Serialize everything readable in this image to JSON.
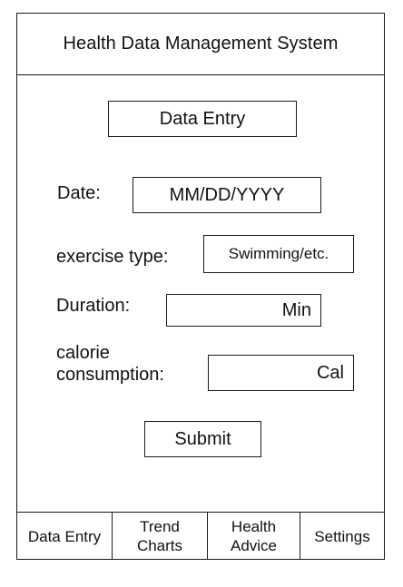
{
  "header": {
    "title": "Health Data Management System"
  },
  "form": {
    "section_button": "Data Entry",
    "date_label": "Date:",
    "date_placeholder": "MM/DD/YYYY",
    "exercise_label": "exercise type:",
    "exercise_placeholder": "Swimming/etc.",
    "duration_label": "Duration:",
    "duration_unit": "Min",
    "calorie_label": "calorie\nconsumption:",
    "calorie_unit": "Cal",
    "submit_label": "Submit"
  },
  "nav": {
    "items": [
      {
        "label": "Data Entry"
      },
      {
        "label": "Trend\nCharts"
      },
      {
        "label": "Health\nAdvice"
      },
      {
        "label": "Settings"
      }
    ]
  }
}
